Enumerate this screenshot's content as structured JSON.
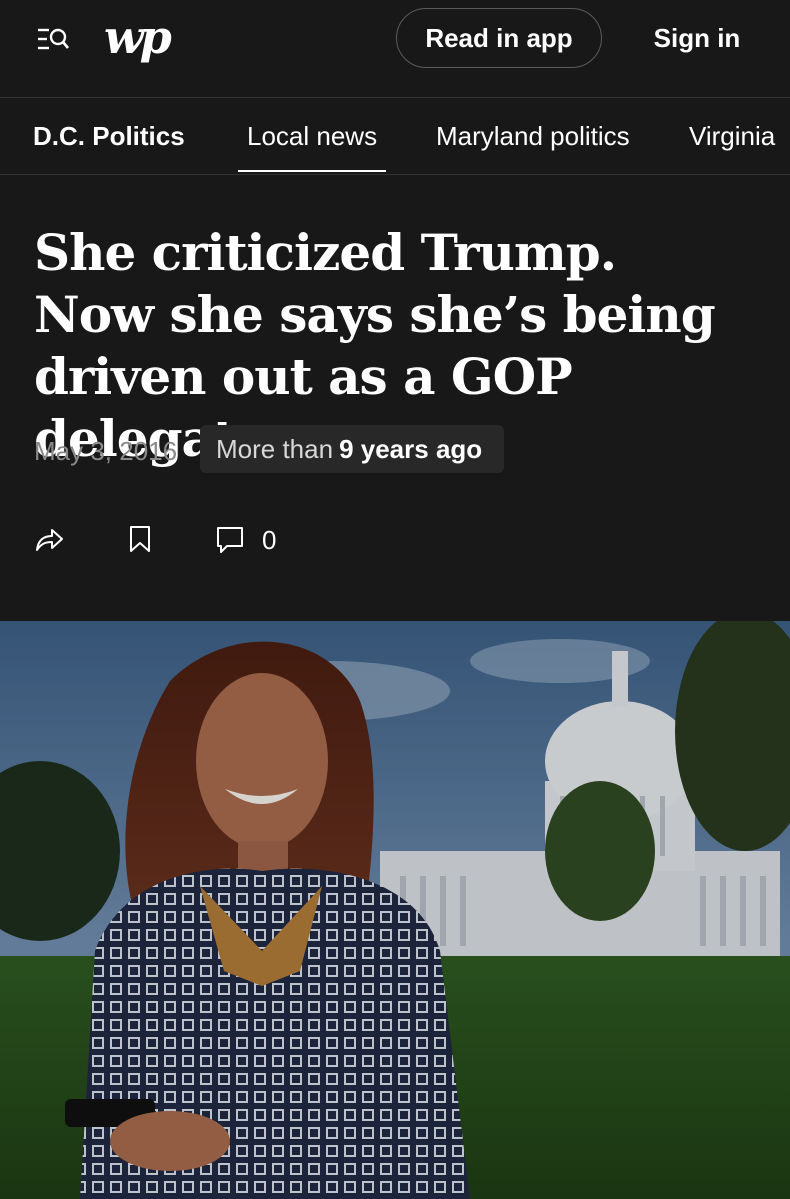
{
  "header": {
    "logo": "wp",
    "read_in_app": "Read in app",
    "sign_in": "Sign in"
  },
  "nav": {
    "items": [
      {
        "label": "D.C. Politics"
      },
      {
        "label": "Local news",
        "active": true
      },
      {
        "label": "Maryland politics"
      },
      {
        "label": "Virginia"
      }
    ]
  },
  "article": {
    "headline": "She criticized Trump. Now she says she’s being driven out as a GOP delegate.",
    "date": "May 3, 2016",
    "age_prefix": "More than",
    "age_value": "9 years ago",
    "comment_count": "0"
  },
  "icons": [
    "menu-search-icon",
    "share-icon",
    "bookmark-icon",
    "comment-icon"
  ],
  "colors": {
    "background": "#181818",
    "badge": "#282828",
    "muted_text": "#8a8a8a"
  }
}
